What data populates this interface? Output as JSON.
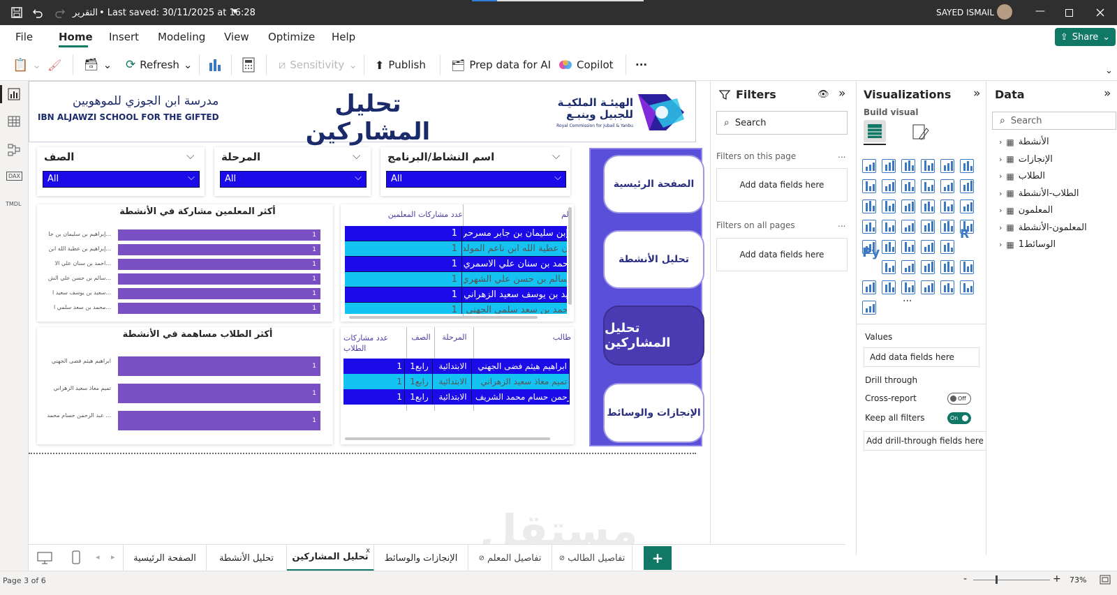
{
  "titlebar": {
    "doc_title": "التقرير",
    "saved": "• Last saved: 30/11/2025 at 16:28",
    "user": "SAYED ISMAIL"
  },
  "menu": [
    "File",
    "Home",
    "Insert",
    "Modeling",
    "View",
    "Optimize",
    "Help"
  ],
  "share_label": "Share",
  "toolbar": {
    "refresh": "Refresh",
    "sensitivity": "Sensitivity",
    "publish": "Publish",
    "prep": "Prep data for AI",
    "copilot": "Copilot",
    "more": "···"
  },
  "header": {
    "school_ar": "مدرسة ابن الجوزي للموهوبين",
    "school_en": "IBN ALJAWZI SCHOOL FOR THE GIFTED",
    "title": "تحليل المشاركين",
    "rc_ar1": "الهيئـة الملكيـة",
    "rc_ar2": "للجبيل وينبـع",
    "rc_en": "Royal Commission for Jubail & Yanbu"
  },
  "slicers": [
    {
      "title": "الصف",
      "value": "All"
    },
    {
      "title": "المرحلة",
      "value": "All"
    },
    {
      "title": "اسم النشاط/البرنامج",
      "value": "All"
    }
  ],
  "nav_buttons": [
    "الصفحة الرئيسية",
    "تحليل الأنشطة",
    "تحليل المشاركين",
    "الإنجازات والوسائط"
  ],
  "teacher_chart": {
    "title": "أكثر المعلمين مشاركة في الأنشطة",
    "labels": [
      "إبراهيم بن سليمان بن جا...",
      "إبراهيم بن عطية الله ابن...",
      "احمد بن سنان علي الا...",
      "سالم بن حسن علي الش...",
      "سعيد بن يوسف سعيد ا...",
      "محمد بن سعد سلمي ا..."
    ]
  },
  "student_chart": {
    "title": "أكثر الطلاب مساهمة في الأنشطة",
    "labels": [
      "ابراهيم هيثم فضى الجهني",
      "تميم معاذ سعيد الزهراني",
      "عبد الرحمن حسام محمد ..."
    ]
  },
  "chart_data": [
    {
      "type": "bar",
      "title": "أكثر المعلمين مشاركة في الأنشطة",
      "categories": [
        "إبراهيم بن سليمان بن جا...",
        "إبراهيم بن عطية الله ابن...",
        "احمد بن سنان علي الا...",
        "سالم بن حسن علي الش...",
        "سعيد بن يوسف سعيد ا...",
        "محمد بن سعد سلمي ا..."
      ],
      "values": [
        1,
        1,
        1,
        1,
        1,
        1
      ]
    },
    {
      "type": "bar",
      "title": "أكثر الطلاب مساهمة في الأنشطة",
      "categories": [
        "ابراهيم هيثم فضى الجهني",
        "تميم معاذ سعيد الزهراني",
        "عبد الرحمن حسام محمد ..."
      ],
      "values": [
        1,
        1,
        1
      ]
    }
  ],
  "teacher_table": {
    "headers": [
      "لم",
      "عدد مشاركات المعلمين"
    ],
    "rows": [
      [
        "إبن سليمان بن جابر مسرحي",
        "1"
      ],
      [
        "ن عطية الله ابن ناعم المولد",
        "1"
      ],
      [
        "حمد بن سنان علي الاسمري",
        "1"
      ],
      [
        "سالم بن حسن علي الشهري",
        "1"
      ],
      [
        "يد بن يوسف سعيد الزهراني",
        "1"
      ],
      [
        "حمد بن سعد سلمي الجهني",
        "1"
      ]
    ]
  },
  "student_table": {
    "headers": [
      "طالب",
      "المرحلة",
      "الصف",
      "عدد مشاركات الطلاب"
    ],
    "rows": [
      [
        "ابراهيم هيثم فضى الجهني",
        "الابتدائية",
        "رابع1",
        "1"
      ],
      [
        "تميم معاذ سعيد الزهراني",
        "الابتدائية",
        "رابع1",
        "1"
      ],
      [
        "رحمن حسام محمد الشريف",
        "الابتدائية",
        "رابع1",
        "1"
      ]
    ]
  },
  "filters": {
    "title": "Filters",
    "search": "Search",
    "on_page": "Filters on this page",
    "on_all": "Filters on all pages",
    "add": "Add data fields here",
    "more": "..."
  },
  "viz": {
    "title": "Visualizations",
    "build": "Build visual",
    "values": "Values",
    "add": "Add data fields here",
    "drill": "Drill through",
    "cross": "Cross-report",
    "cross_state": "Off",
    "keep": "Keep all filters",
    "keep_state": "On",
    "add_drill": "Add drill-through fields here",
    "py": "Py",
    "r": "R",
    "more": "···"
  },
  "data": {
    "title": "Data",
    "search": "Search",
    "tables": [
      "الأنشطة",
      "الإنجازات",
      "الطلاب",
      "الطلاب-الأنشطة",
      "المعلمون",
      "المعلمون-الأنشطة",
      "الوسائط1"
    ]
  },
  "tabs": [
    "الصفحة الرئيسية",
    "تحليل الأنشطة",
    "تحليل المشاركين",
    "الإنجازات والوسائط",
    "تفاصيل المعلم",
    "تفاصيل الطالب"
  ],
  "tab_close": "x",
  "add_tab": "+",
  "status": {
    "page": "Page 3 of 6",
    "zoom": "73%"
  },
  "watermark": "مستقل"
}
